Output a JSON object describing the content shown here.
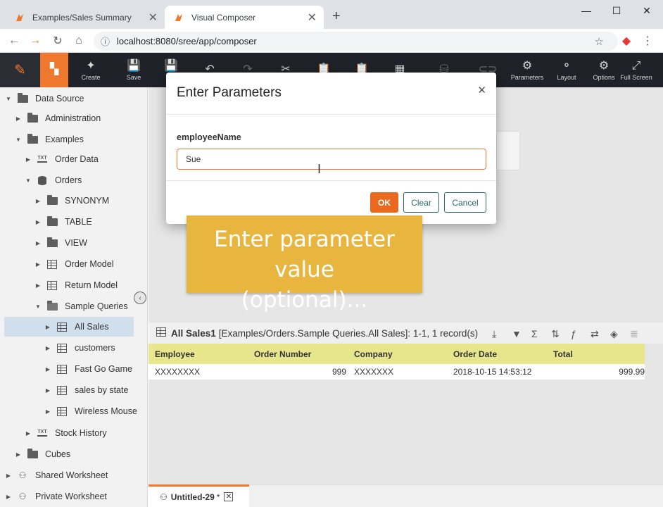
{
  "browser": {
    "tabs": [
      {
        "label": "Examples/Sales Summary",
        "active": false
      },
      {
        "label": "Visual Composer",
        "active": true
      }
    ],
    "new_tab": "+",
    "url": "localhost:8080/sree/app/composer"
  },
  "toolbar": {
    "buttons": [
      {
        "label": "Create",
        "icon": "✦"
      },
      {
        "label": "Save",
        "icon": "💾"
      },
      {
        "label": "Sa",
        "icon": "💾"
      },
      {
        "label": "",
        "icon": "↶"
      },
      {
        "label": "",
        "icon": "↷"
      },
      {
        "label": "",
        "icon": "✂"
      },
      {
        "label": "",
        "icon": "📋"
      },
      {
        "label": "",
        "icon": "📋"
      },
      {
        "label": "",
        "icon": "▦"
      },
      {
        "label": "",
        "icon": "⛁"
      },
      {
        "label": "",
        "icon": "⊂⊃"
      },
      {
        "label": "Parameters",
        "icon": "⚙"
      },
      {
        "label": "Layout",
        "icon": "⚬"
      },
      {
        "label": "Options",
        "icon": "⚙"
      },
      {
        "label": "Full Screen",
        "icon": "⤢"
      }
    ]
  },
  "sidebar": {
    "items": [
      {
        "label": "Data Source"
      },
      {
        "label": "Administration"
      },
      {
        "label": "Examples"
      },
      {
        "label": "Order Data"
      },
      {
        "label": "Orders"
      },
      {
        "label": "SYNONYM"
      },
      {
        "label": "TABLE"
      },
      {
        "label": "VIEW"
      },
      {
        "label": "Order Model"
      },
      {
        "label": "Return Model"
      },
      {
        "label": "Sample Queries"
      },
      {
        "label": "All Sales"
      },
      {
        "label": "customers"
      },
      {
        "label": "Fast Go Game"
      },
      {
        "label": "sales by state"
      },
      {
        "label": "Wireless Mouse"
      },
      {
        "label": "Stock History"
      },
      {
        "label": "Cubes"
      },
      {
        "label": "Shared Worksheet"
      },
      {
        "label": "Private Worksheet"
      }
    ]
  },
  "preview": {
    "title": "All Sales1",
    "path": "[Examples/Orders.Sample Queries.All Sales]: 1-1, 1 record(s)",
    "columns": [
      "Employee",
      "Order Number",
      "Company",
      "Order Date",
      "Total"
    ],
    "row": [
      "XXXXXXXX",
      "999",
      "XXXXXXX",
      "2018-10-15 14:53:12",
      "999.99"
    ]
  },
  "bottom_tab": {
    "label": "Untitled-29",
    "modified": "*"
  },
  "dialog": {
    "title": "Enter Parameters",
    "param_label": "employeeName",
    "param_value": "Sue",
    "ok": "OK",
    "clear": "Clear",
    "cancel": "Cancel"
  },
  "callout": {
    "line1": "Enter parameter value",
    "line2": "(optional)..."
  },
  "colors": {
    "accent": "#f0782d",
    "toolbar_bg": "#1f2228",
    "callout": "#e8b53f",
    "table_header": "#e8e68d"
  }
}
